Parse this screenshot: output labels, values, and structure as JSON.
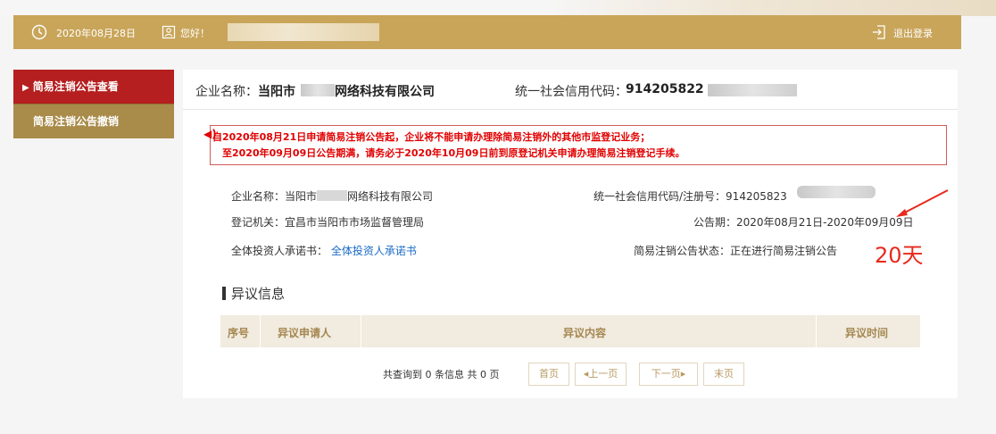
{
  "header": {
    "date": "2020年08月28日",
    "greeting": "您好！",
    "logout_label": "退出登录",
    "icons": {
      "clock": "clock-icon",
      "user": "user-card-icon",
      "logout": "logout-icon"
    }
  },
  "sidebar": {
    "items": [
      {
        "label": "简易注销公告查看",
        "active": true
      },
      {
        "label": "简易注销公告撤销",
        "active": false
      }
    ]
  },
  "top_info": {
    "company_label": "企业名称：",
    "company_prefix": "当阳市",
    "company_suffix": "网络科技有限公司",
    "credit_label": "统一社会信用代码：",
    "credit_code": "914205822"
  },
  "notice": {
    "line1": "自2020年08月21日申请简易注销公告起，企业将不能申请办理除简易注销外的其他市监登记业务；",
    "line2": "至2020年09月09日公告期满，请务必于2020年10月09日前到原登记机关申请办理简易注销登记手续。"
  },
  "details": {
    "company_name_label": "企业名称：当阳市",
    "company_name_suffix": "网络科技有限公司",
    "credit_reg_label": "统一社会信用代码/注册号：914205823",
    "registration_authority": "登记机关：宜昌市当阳市市场监督管理局",
    "announcement_period": "公告期：2020年08月21日-2020年09月09日",
    "commitment_label": "全体投资人承诺书：",
    "commitment_link": "全体投资人承诺书",
    "status": "简易注销公告状态：正在进行简易注销公告",
    "days_annotation": "20天"
  },
  "objection": {
    "title": "异议信息",
    "columns": [
      "序号",
      "异议申请人",
      "异议内容",
      "异议时间"
    ]
  },
  "pagination": {
    "summary": "共查询到 0 条信息  共 0 页",
    "first": "首页",
    "prev": "◂上一页",
    "next": "下一页▸",
    "last": "末页"
  },
  "colors": {
    "header_bg": "#c9a55a",
    "sidebar_active": "#b51f1f",
    "sidebar_normal": "#a98b4a",
    "notice_red": "#e10000",
    "annotation_red": "#e8291c",
    "link_blue": "#1a6bc8"
  }
}
